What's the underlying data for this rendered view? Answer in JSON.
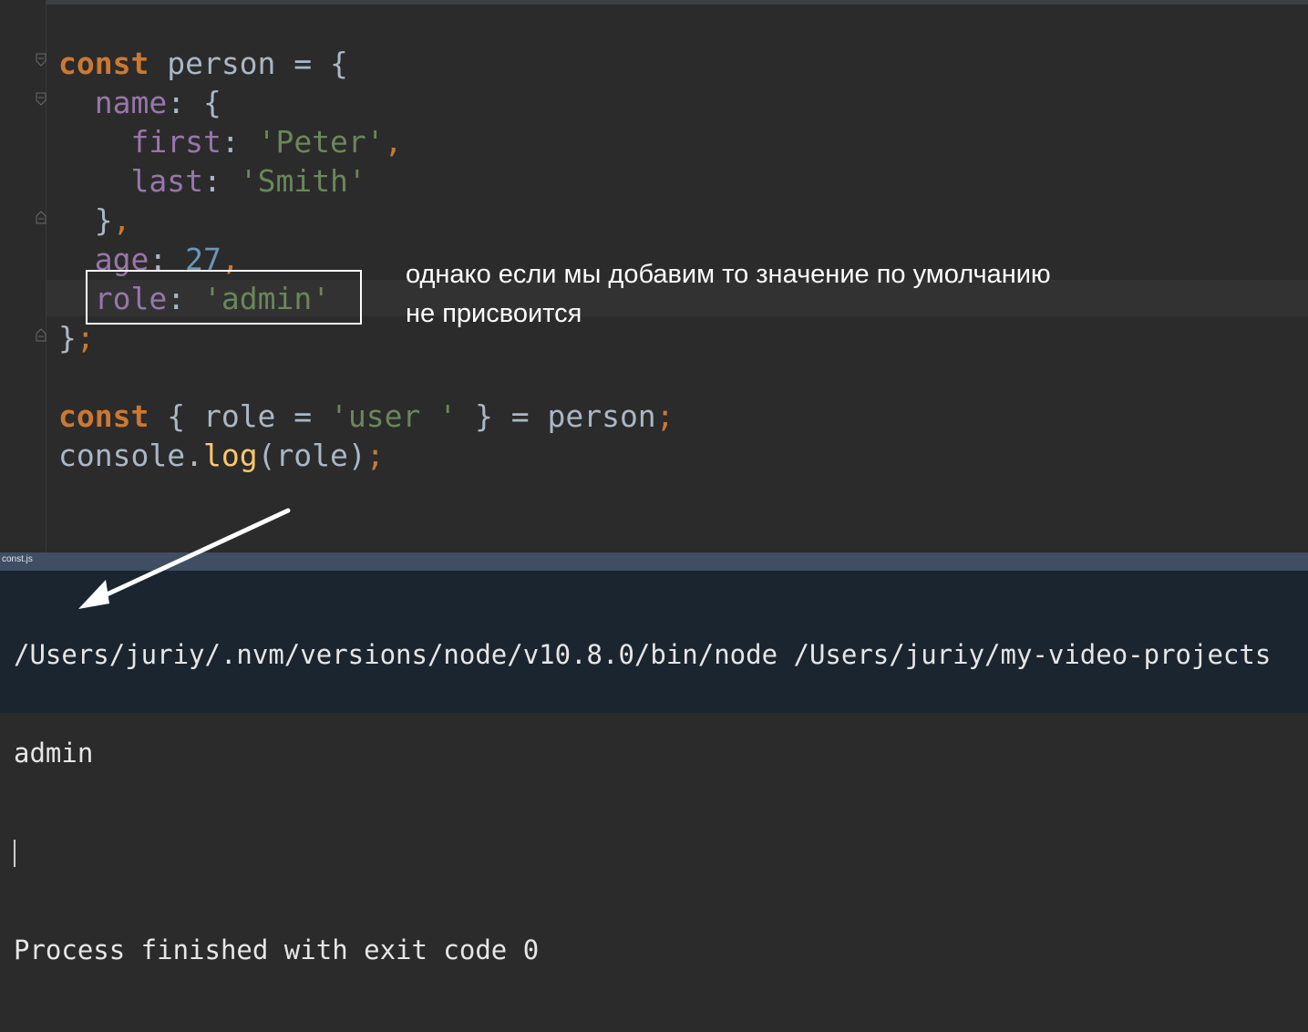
{
  "editor": {
    "lines": [
      [
        {
          "c": "kw",
          "t": "const"
        },
        {
          "c": "ident",
          "t": " person "
        },
        {
          "c": "punc",
          "t": "= {"
        }
      ],
      [
        {
          "c": "ident",
          "t": "  "
        },
        {
          "c": "prop",
          "t": "name"
        },
        {
          "c": "punc",
          "t": ": {"
        }
      ],
      [
        {
          "c": "ident",
          "t": "    "
        },
        {
          "c": "prop",
          "t": "first"
        },
        {
          "c": "punc",
          "t": ": "
        },
        {
          "c": "str",
          "t": "'Peter'"
        },
        {
          "c": "semi",
          "t": ","
        }
      ],
      [
        {
          "c": "ident",
          "t": "    "
        },
        {
          "c": "prop",
          "t": "last"
        },
        {
          "c": "punc",
          "t": ": "
        },
        {
          "c": "str",
          "t": "'Smith'"
        }
      ],
      [
        {
          "c": "ident",
          "t": "  "
        },
        {
          "c": "punc",
          "t": "}"
        },
        {
          "c": "semi",
          "t": ","
        }
      ],
      [
        {
          "c": "ident",
          "t": "  "
        },
        {
          "c": "prop",
          "t": "age"
        },
        {
          "c": "punc",
          "t": ": "
        },
        {
          "c": "num",
          "t": "27"
        },
        {
          "c": "semi",
          "t": ","
        }
      ],
      [
        {
          "c": "ident",
          "t": "  "
        },
        {
          "c": "prop",
          "t": "role"
        },
        {
          "c": "punc",
          "t": ": "
        },
        {
          "c": "str",
          "t": "'admin'"
        }
      ],
      [
        {
          "c": "punc",
          "t": "}"
        },
        {
          "c": "semi",
          "t": ";"
        }
      ],
      [
        {
          "c": "ident",
          "t": ""
        }
      ],
      [
        {
          "c": "kw",
          "t": "const"
        },
        {
          "c": "punc",
          "t": " { "
        },
        {
          "c": "ident",
          "t": "role "
        },
        {
          "c": "punc",
          "t": "= "
        },
        {
          "c": "str",
          "t": "'user '"
        },
        {
          "c": "punc",
          "t": " } = "
        },
        {
          "c": "ident",
          "t": "person"
        },
        {
          "c": "semi",
          "t": ";"
        }
      ],
      [
        {
          "c": "ident",
          "t": "console."
        },
        {
          "c": "fn",
          "t": "log"
        },
        {
          "c": "punc",
          "t": "("
        },
        {
          "c": "ident",
          "t": "role"
        },
        {
          "c": "punc",
          "t": ")"
        },
        {
          "c": "semi",
          "t": ";"
        }
      ]
    ]
  },
  "annotation": {
    "line1": "однако если мы добавим то значение по умолчанию",
    "line2": "не присвоится"
  },
  "terminal": {
    "tab_label": "const.js",
    "command": "/Users/juriy/.nvm/versions/node/v10.8.0/bin/node /Users/juriy/my-video-projects",
    "output": "admin",
    "exit_message": "Process finished with exit code 0"
  },
  "colors": {
    "keyword": "#cc7832",
    "property": "#9876aa",
    "string": "#6a8759",
    "number": "#6897bb",
    "function": "#ffc66d",
    "annotation_box": "#ffffff",
    "terminal_bg": "#1a2530"
  }
}
